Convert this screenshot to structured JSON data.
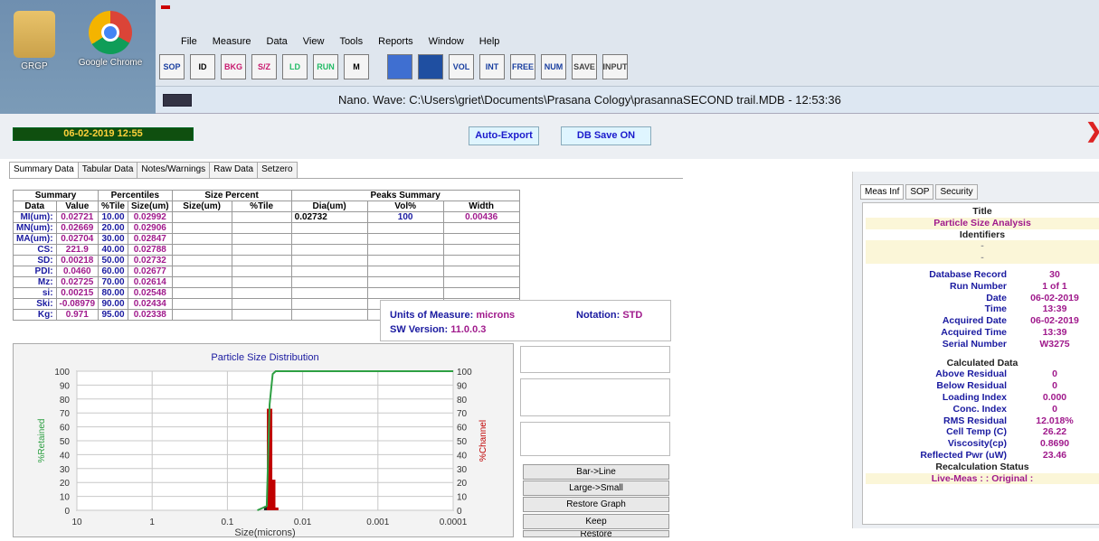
{
  "desktop": {
    "icons": [
      {
        "label": "GRGP"
      },
      {
        "label": "Google Chrome"
      }
    ]
  },
  "menu": [
    "File",
    "Measure",
    "Data",
    "View",
    "Tools",
    "Reports",
    "Window",
    "Help"
  ],
  "toolbar": [
    "SOP",
    "ID",
    "BKG",
    "S/Z",
    "LD",
    "RUN",
    "M",
    "",
    "",
    "VOL",
    "INT",
    "FREE",
    "NUM",
    "SAVE",
    "INPUT"
  ],
  "window_title": "Nano. Wave: C:\\Users\\griet\\Documents\\Prasana Cology\\prasannaSECOND trail.MDB - 12:53:36",
  "datetime": "06-02-2019 12:55",
  "buttons": {
    "auto_export": "Auto-Export",
    "db_save": "DB Save ON"
  },
  "tabs": [
    "Summary Data",
    "Tabular Data",
    "Notes/Warnings",
    "Raw Data",
    "Setzero"
  ],
  "summary": {
    "headers": {
      "summary": "Summary",
      "percentiles": "Percentiles",
      "size_percent": "Size Percent",
      "peaks": "Peaks Summary"
    },
    "subheaders": [
      "Data",
      "Value",
      "%Tile",
      "Size(um)",
      "Size(um)",
      "%Tile",
      "Dia(um)",
      "Vol%",
      "Width"
    ],
    "rows": [
      [
        "MI(um):",
        "0.02721",
        "10.00",
        "0.02992"
      ],
      [
        "MN(um):",
        "0.02669",
        "20.00",
        "0.02906"
      ],
      [
        "MA(um):",
        "0.02704",
        "30.00",
        "0.02847"
      ],
      [
        "CS:",
        "221.9",
        "40.00",
        "0.02788"
      ],
      [
        "SD:",
        "0.00218",
        "50.00",
        "0.02732"
      ],
      [
        "PDI:",
        "0.0460",
        "60.00",
        "0.02677"
      ],
      [
        "Mz:",
        "0.02725",
        "70.00",
        "0.02614"
      ],
      [
        "si:",
        "0.00215",
        "80.00",
        "0.02548"
      ],
      [
        "Ski:",
        "-0.08979",
        "90.00",
        "0.02434"
      ],
      [
        "Kg:",
        "0.971",
        "95.00",
        "0.02338"
      ]
    ],
    "peak": [
      "0.02732",
      "100",
      "0.00436"
    ]
  },
  "units": {
    "label": "Units of Measure:",
    "value": "microns",
    "notation_label": "Notation:",
    "notation": "STD",
    "sw_label": "SW Version:",
    "sw": "11.0.0.3"
  },
  "chart_buttons": [
    "Bar->Line",
    "Large->Small",
    "Restore Graph",
    "Keep",
    "Restore"
  ],
  "chart_data": {
    "type": "bar",
    "title": "Particle Size Distribution",
    "xlabel": "Size(microns)",
    "ylabel_left": "%Retained",
    "ylabel_right": "%Channel",
    "x_ticks": [
      "10",
      "1",
      "0.1",
      "0.01",
      "0.001",
      "0.0001"
    ],
    "y_ticks": [
      "0",
      "10",
      "20",
      "30",
      "40",
      "50",
      "60",
      "70",
      "80",
      "90",
      "100"
    ],
    "ylim": [
      0,
      100
    ],
    "log_x": true,
    "x_reversed": true,
    "grid": true,
    "series": [
      {
        "values": [
          {
            "x": 0.03,
            "y": 3
          },
          {
            "x": 0.0275,
            "y": 73
          },
          {
            "x": 0.025,
            "y": 22
          },
          {
            "x": 0.0228,
            "y": 2
          }
        ],
        "color": "#c00000"
      },
      {
        "values": [
          {
            "x": 0.04,
            "y": 0
          },
          {
            "x": 0.03,
            "y": 3
          },
          {
            "x": 0.0275,
            "y": 76
          },
          {
            "x": 0.025,
            "y": 98
          },
          {
            "x": 0.0228,
            "y": 100
          },
          {
            "x": 0.0001,
            "y": 100
          }
        ],
        "color": "#2ea043"
      }
    ]
  },
  "right_tabs": [
    "Meas Inf",
    "SOP",
    "Security"
  ],
  "info": {
    "title_h": "Title",
    "title_v": "Particle Size Analysis",
    "ident_h": "Identifiers",
    "dash1": "-",
    "dash2": "-",
    "rows1": [
      [
        "Database Record",
        "30"
      ],
      [
        "Run Number",
        "1 of 1"
      ],
      [
        "Date",
        "06-02-2019"
      ],
      [
        "Time",
        "13:39"
      ],
      [
        "Acquired Date",
        "06-02-2019"
      ],
      [
        "Acquired Time",
        "13:39"
      ],
      [
        "Serial Number",
        "W3275"
      ]
    ],
    "calc_h": "Calculated Data",
    "rows2": [
      [
        "Above Residual",
        "0"
      ],
      [
        "Below Residual",
        "0"
      ],
      [
        "Loading Index",
        "0.000"
      ],
      [
        "Conc. Index",
        "0"
      ],
      [
        "RMS Residual",
        "12.018%"
      ],
      [
        "Cell Temp (C)",
        "26.22"
      ],
      [
        "Viscosity(cp)",
        "0.8690"
      ],
      [
        "Reflected Pwr (uW)",
        "23.46"
      ]
    ],
    "recalc_h": "Recalculation Status",
    "recalc_v": "Live-Meas : : Original :"
  },
  "colors": {
    "accent": "#1a1aa0",
    "value": "#a01a8c",
    "date_bg": "#0f4f0f",
    "date_fg": "#ffd23a"
  }
}
